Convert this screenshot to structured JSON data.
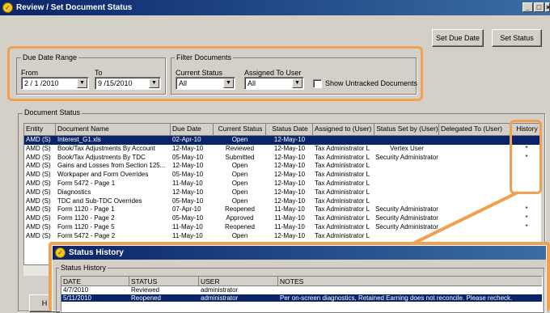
{
  "window": {
    "title": "Review / Set Document Status"
  },
  "toolbar": {
    "set_due_date": "Set Due Date",
    "set_status": "Set Status"
  },
  "due_date_range": {
    "label": "Due Date Range",
    "from_label": "From",
    "from_value": "2 / 1 /2010",
    "to_label": "To",
    "to_value": "9 /15/2010"
  },
  "filter": {
    "label": "Filter Documents",
    "status_label": "Current Status",
    "status_value": "All",
    "user_label": "Assigned To User",
    "user_value": "All",
    "untracked_label": "Show Untracked Documents"
  },
  "doc_status": {
    "label": "Document Status",
    "columns": [
      "Entity",
      "Document Name",
      "Due Date",
      "Current Status",
      "Status Date",
      "Assigned to (User)",
      "Status Set by (User)",
      "Delegated To (User)",
      "History"
    ],
    "rows": [
      [
        "AMD (S)",
        "Interest_G1.xls",
        "02-Apr-10",
        "Open",
        "12-May-10",
        "",
        "",
        "",
        ""
      ],
      [
        "AMD (S)",
        "Book/Tax Adjustments By Account",
        "12-May-10",
        "Reviewed",
        "12-May-10",
        "Tax Administrator L",
        "Vertex User",
        "",
        "*"
      ],
      [
        "AMD (S)",
        "Book/Tax Adjustments By TDC",
        "05-May-10",
        "Submitted",
        "12-May-10",
        "Tax Administrator L",
        "Security Administrator",
        "",
        "*"
      ],
      [
        "AMD (S)",
        "Gains and Losses from Section 125...",
        "12-May-10",
        "Open",
        "12-May-10",
        "Tax Administrator L",
        "",
        "",
        ""
      ],
      [
        "AMD (S)",
        "Workpaper and Form Overrides",
        "05-May-10",
        "Open",
        "12-May-10",
        "Tax Administrator L",
        "",
        "",
        ""
      ],
      [
        "AMD (S)",
        "Form 5472 - Page 1",
        "11-May-10",
        "Open",
        "12-May-10",
        "Tax Administrator L",
        "",
        "",
        ""
      ],
      [
        "AMD (S)",
        "Diagnostics",
        "12-May-10",
        "Open",
        "12-May-10",
        "Tax Administrator L",
        "",
        "",
        ""
      ],
      [
        "AMD (S)",
        "TDC and Sub-TDC Overrides",
        "05-May-10",
        "Open",
        "12-May-10",
        "Tax Administrator L",
        "",
        "",
        ""
      ],
      [
        "AMD (S)",
        "Form 1120 - Page 1",
        "07-Apr-10",
        "Reopened",
        "11-May-10",
        "Tax Administrator L",
        "Security Administrator",
        "",
        "*"
      ],
      [
        "AMD (S)",
        "Form 1120 - Page 2",
        "05-May-10",
        "Approved",
        "11-May-10",
        "Tax Administrator L",
        "Security Administrator",
        "",
        "*"
      ],
      [
        "AMD (S)",
        "Form 1120 - Page 5",
        "11-May-10",
        "Reopened",
        "11-May-10",
        "Tax Administrator L",
        "Security Administrator",
        "",
        "*"
      ],
      [
        "AMD (S)",
        "Form 5472 - Page 2",
        "11-May-10",
        "Open",
        "12-May-10",
        "Tax Administrator L",
        "",
        "",
        ""
      ]
    ]
  },
  "history_popup": {
    "title": "Status History",
    "group_label": "Status History",
    "columns": [
      "DATE",
      "STATUS",
      "USER",
      "NOTES"
    ],
    "rows": [
      [
        "4/7/2010",
        "Reviewed",
        "administrator",
        ""
      ],
      [
        "5/11/2010",
        "Reopened",
        "administrator",
        "Per on-screen diagnostics, Retained Earning does not reconcile.  Please recheck."
      ]
    ]
  },
  "bottom_button": {
    "label": "H"
  },
  "colors": {
    "highlight": "#f0a050",
    "selection": "#0a246a",
    "title_start": "#0a246a"
  }
}
